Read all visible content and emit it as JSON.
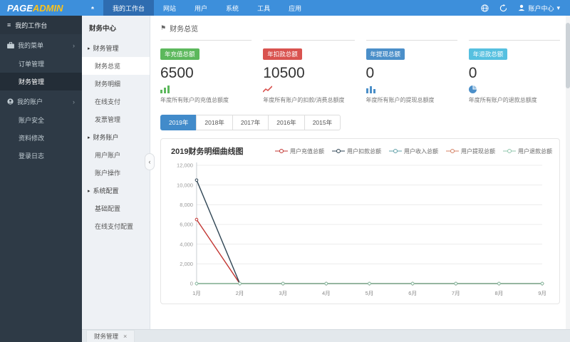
{
  "topbar": {
    "logo": {
      "part1": "PAGE",
      "part2": "ADMIN"
    },
    "nav": [
      {
        "label": "我的工作台",
        "active": true
      },
      {
        "label": "网站"
      },
      {
        "label": "用户"
      },
      {
        "label": "系统"
      },
      {
        "label": "工具"
      },
      {
        "label": "应用"
      }
    ],
    "account_label": "账户中心"
  },
  "icons": {
    "hamburger": "≡",
    "chevron_right": "›",
    "submenu_caret": "▸",
    "collapse_left": "‹",
    "caret_down": "▾",
    "close": "×",
    "flag": "⚑"
  },
  "sidebar": {
    "header": "我的工作台",
    "groups": [
      {
        "label": "我的菜单",
        "items": [
          {
            "label": "订单管理"
          },
          {
            "label": "财务管理",
            "active": true
          }
        ]
      },
      {
        "label": "我的账户",
        "items": [
          {
            "label": "账户安全"
          },
          {
            "label": "资料修改"
          },
          {
            "label": "登录日志"
          }
        ]
      }
    ]
  },
  "submenu": {
    "header": "财务中心",
    "items": [
      {
        "label": "财务管理",
        "group": true
      },
      {
        "label": "财务总览",
        "active": true
      },
      {
        "label": "财务明细"
      },
      {
        "label": "在线支付"
      },
      {
        "label": "发票管理"
      },
      {
        "label": "财务账户",
        "group": true
      },
      {
        "label": "用户账户"
      },
      {
        "label": "账户操作"
      },
      {
        "label": "系统配置",
        "group": true
      },
      {
        "label": "基础配置"
      },
      {
        "label": "在线支付配置"
      }
    ]
  },
  "main": {
    "page_title": "财务总览",
    "cards": [
      {
        "badge": "年充值总额",
        "badge_color": "#5cb85c",
        "value": "6500",
        "icon": "bar-chart-icon",
        "icon_color": "#5cb85c",
        "desc": "年度所有账户的充值总额度"
      },
      {
        "badge": "年扣款总额",
        "badge_color": "#d9534f",
        "value": "10500",
        "icon": "line-chart-icon",
        "icon_color": "#d9534f",
        "desc": "年度所有账户的扣款/消费总额度"
      },
      {
        "badge": "年提现总额",
        "badge_color": "#4b8fc9",
        "value": "0",
        "icon": "bar-chart-icon",
        "icon_color": "#4b8fc9",
        "desc": "年度所有账户的提现总额度"
      },
      {
        "badge": "年退款总额",
        "badge_color": "#56c0e0",
        "value": "0",
        "icon": "pie-chart-icon",
        "icon_color": "#4b8fc9",
        "desc": "年度所有账户的退款总额度"
      }
    ],
    "year_tabs": [
      {
        "label": "2019年",
        "active": true
      },
      {
        "label": "2018年"
      },
      {
        "label": "2017年"
      },
      {
        "label": "2016年"
      },
      {
        "label": "2015年"
      }
    ]
  },
  "chart_data": {
    "type": "line",
    "title": "2019财务明细曲线图",
    "categories": [
      "1月",
      "2月",
      "3月",
      "4月",
      "5月",
      "6月",
      "7月",
      "8月",
      "9月"
    ],
    "series": [
      {
        "name": "用户充值总额",
        "color": "#c23531",
        "values": [
          6500,
          0,
          0,
          0,
          0,
          0,
          0,
          0,
          0
        ]
      },
      {
        "name": "用户扣款总额",
        "color": "#2f4554",
        "values": [
          10500,
          0,
          0,
          0,
          0,
          0,
          0,
          0,
          0
        ]
      },
      {
        "name": "用户收入总额",
        "color": "#61a0a8",
        "values": [
          0,
          0,
          0,
          0,
          0,
          0,
          0,
          0,
          0
        ]
      },
      {
        "name": "用户提现总额",
        "color": "#d48265",
        "values": [
          0,
          0,
          0,
          0,
          0,
          0,
          0,
          0,
          0
        ]
      },
      {
        "name": "用户退款总额",
        "color": "#91c7ae",
        "values": [
          0,
          0,
          0,
          0,
          0,
          0,
          0,
          0,
          0
        ]
      }
    ],
    "ylim": [
      0,
      12000
    ],
    "ytick_step": 2000,
    "grid": true,
    "legend_position": "top-right"
  },
  "footer": {
    "tabs": [
      {
        "label": "财务管理",
        "closable": true
      }
    ]
  }
}
